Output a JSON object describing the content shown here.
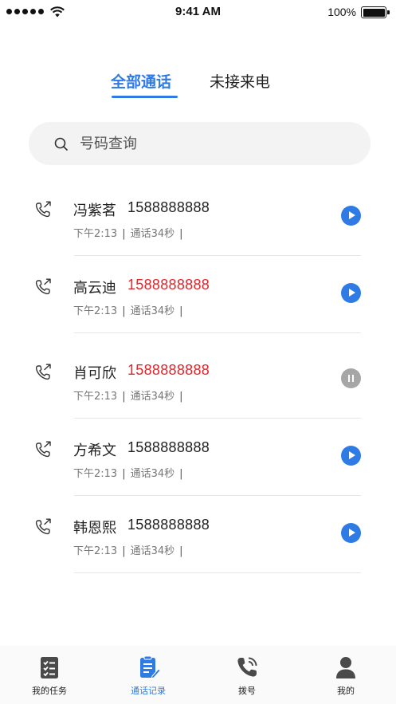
{
  "status_bar": {
    "time": "9:41 AM",
    "battery": "100%"
  },
  "tabs": [
    {
      "label": "全部通话",
      "active": true
    },
    {
      "label": "未接来电",
      "active": false
    }
  ],
  "search": {
    "placeholder": "号码查询"
  },
  "calls": [
    {
      "name": "冯紫茗",
      "number": "1588888888",
      "number_color": "#222222",
      "time": "下午2:13",
      "duration": "通话34秒",
      "playback": "play"
    },
    {
      "name": "高云迪",
      "number": "1588888888",
      "number_color": "#e0252b",
      "time": "下午2:13",
      "duration": "通话34秒",
      "playback": "play"
    },
    {
      "name": "肖可欣",
      "number": "1588888888",
      "number_color": "#e0252b",
      "time": "下午2:13",
      "duration": "通话34秒",
      "playback": "pause"
    },
    {
      "name": "方希文",
      "number": "1588888888",
      "number_color": "#222222",
      "time": "下午2:13",
      "duration": "通话34秒",
      "playback": "play"
    },
    {
      "name": "韩恩熙",
      "number": "1588888888",
      "number_color": "#222222",
      "time": "下午2:13",
      "duration": "通话34秒",
      "playback": "play"
    }
  ],
  "bottom_nav": [
    {
      "label": "我的任务",
      "icon": "task-list-icon",
      "active": false
    },
    {
      "label": "通话记录",
      "icon": "call-record-icon",
      "active": true
    },
    {
      "label": "拨号",
      "icon": "dial-phone-icon",
      "active": false
    },
    {
      "label": "我的",
      "icon": "person-icon",
      "active": false
    }
  ],
  "colors": {
    "accent": "#2f7be5",
    "missed": "#e0252b",
    "paused": "#a6a6a6"
  }
}
